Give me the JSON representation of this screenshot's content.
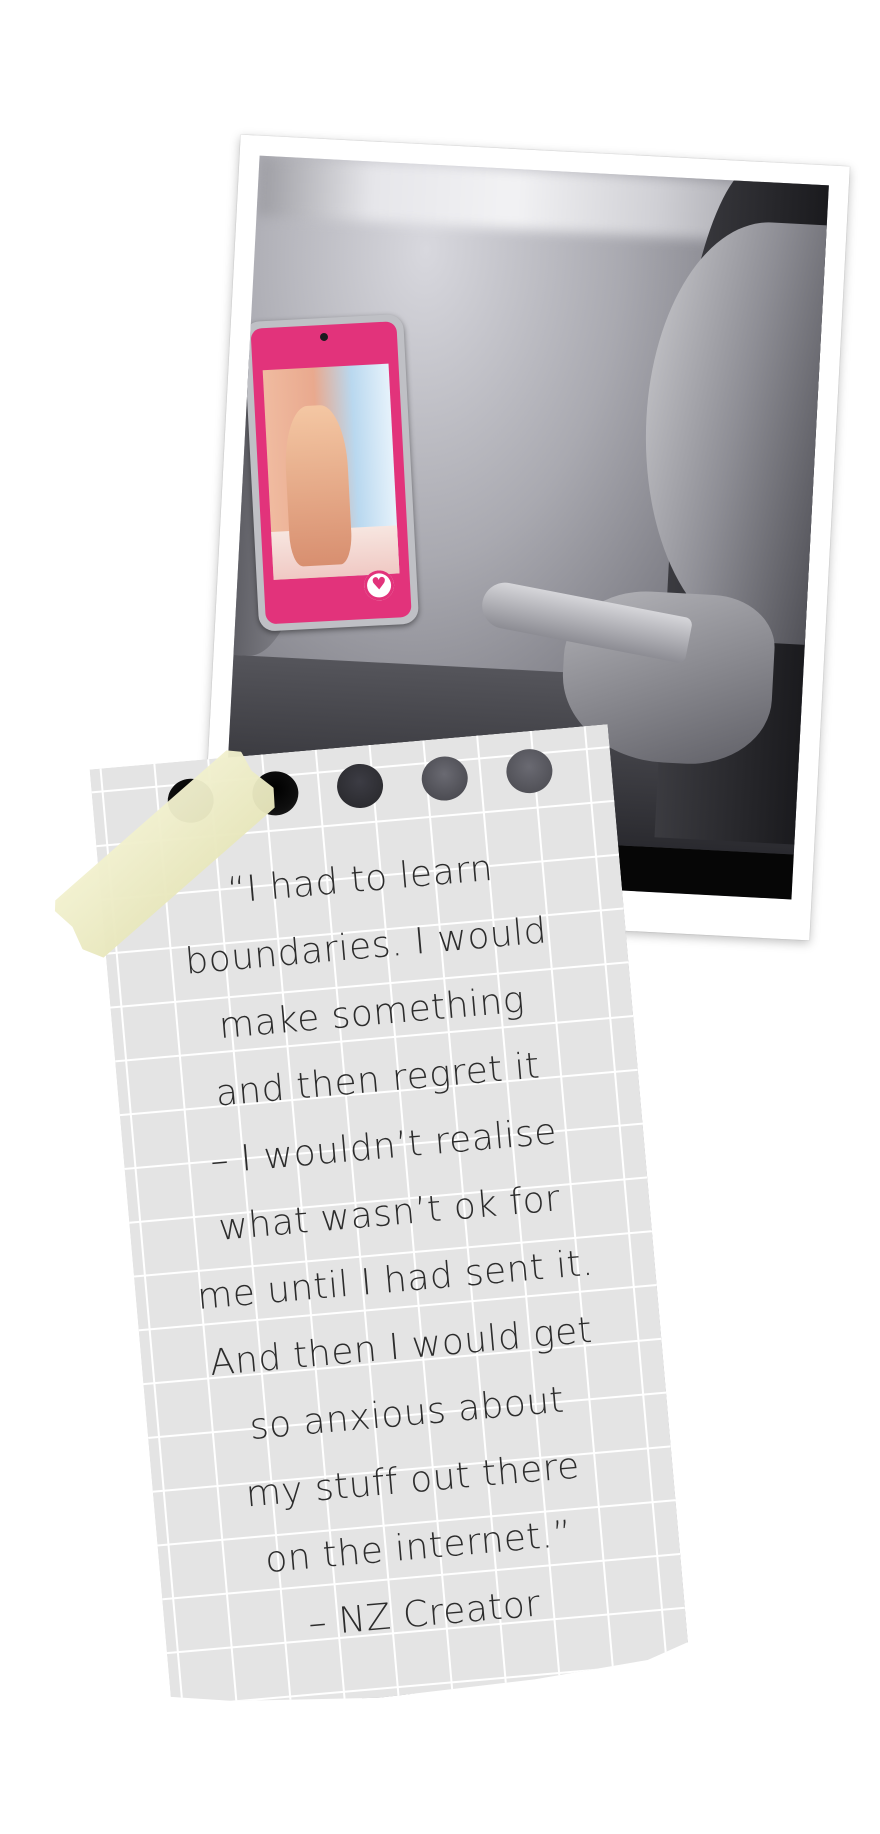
{
  "quote": {
    "lines": [
      "“I had to learn",
      "boundaries. I would",
      "make something",
      "and then regret it",
      "– I wouldn’t realise",
      "what wasn’t ok for",
      "me until I had sent it.",
      "And then I would get",
      "so anxious about",
      "my stuff out there",
      "on the internet.”",
      "– NZ Creator"
    ]
  },
  "photo": {
    "description_icon": "phone-in-hand-photo",
    "phone_screen_color": "#e2337b",
    "heart_icon": "heart-icon"
  },
  "colors": {
    "paper": "#e4e4e4",
    "grid": "#ffffff",
    "tape": "#efeec8",
    "text": "#2c2c2c"
  }
}
